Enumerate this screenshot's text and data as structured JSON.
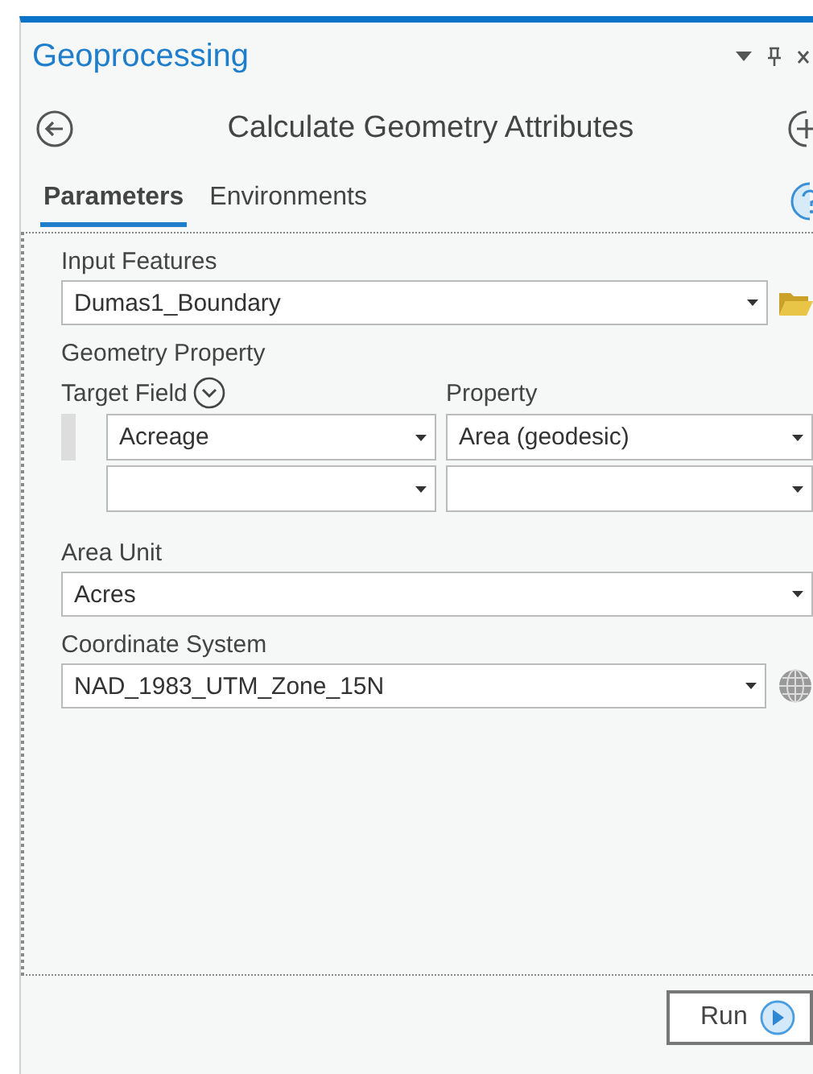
{
  "panel": {
    "title": "Geoprocessing"
  },
  "tool": {
    "title": "Calculate Geometry Attributes"
  },
  "tabs": [
    {
      "label": "Parameters",
      "selected": true
    },
    {
      "label": "Environments",
      "selected": false
    }
  ],
  "input_features": {
    "label": "Input Features",
    "value": "Dumas1_Boundary"
  },
  "geometry_property": {
    "label": "Geometry Property",
    "columns": [
      "Target Field",
      "Property"
    ],
    "rows": [
      {
        "kind": "filled",
        "target_field": "Acreage",
        "property": "Area (geodesic)"
      },
      {
        "kind": "empty"
      }
    ]
  },
  "area_unit": {
    "label": "Area Unit",
    "value": "Acres"
  },
  "coordinate_system": {
    "label": "Coordinate System",
    "value": "NAD_1983_UTM_Zone_15N"
  },
  "run_button": {
    "label": "Run"
  }
}
